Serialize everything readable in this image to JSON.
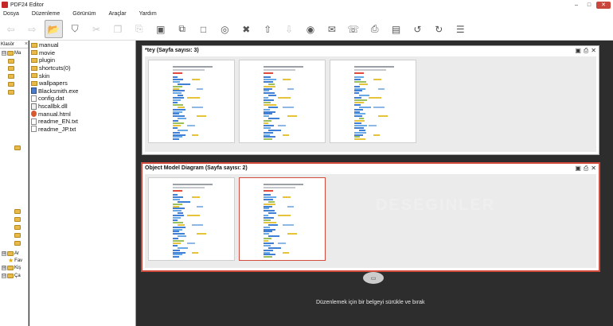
{
  "app": {
    "title": "PDF24 Editor"
  },
  "window_buttons": {
    "minimize": "–",
    "maximize": "□",
    "close": "✕"
  },
  "menu": [
    "Dosya",
    "Düzenleme",
    "Görünüm",
    "Araçlar",
    "Yardım"
  ],
  "toolbar": [
    {
      "name": "back-arrow",
      "icon": "arrow-left-icon",
      "glyph": "⇦",
      "state": "disabled"
    },
    {
      "name": "forward-arrow",
      "icon": "arrow-right-icon",
      "glyph": "⇨",
      "state": "disabled"
    },
    {
      "name": "open-folder",
      "icon": "folder-open-icon",
      "glyph": "📂",
      "state": "active"
    },
    {
      "name": "save-pdf",
      "icon": "shield-save-icon",
      "glyph": "⛉",
      "state": "normal"
    },
    {
      "name": "cut",
      "icon": "scissors-icon",
      "glyph": "✂",
      "state": "disabled"
    },
    {
      "name": "copy",
      "icon": "copy-icon",
      "glyph": "❐",
      "state": "disabled"
    },
    {
      "name": "paste",
      "icon": "paste-icon",
      "glyph": "⎘",
      "state": "disabled"
    },
    {
      "name": "save",
      "icon": "disk-icon",
      "glyph": "▣",
      "state": "normal"
    },
    {
      "name": "save-as",
      "icon": "save-as-icon",
      "glyph": "⧉",
      "state": "normal"
    },
    {
      "name": "new-page",
      "icon": "blank-page-icon",
      "glyph": "□",
      "state": "normal"
    },
    {
      "name": "merge",
      "icon": "merge-rings-icon",
      "glyph": "◎",
      "state": "normal"
    },
    {
      "name": "delete",
      "icon": "delete-x-icon",
      "glyph": "✖",
      "state": "normal"
    },
    {
      "name": "upload",
      "icon": "up-arrow-icon",
      "glyph": "⇧",
      "state": "normal"
    },
    {
      "name": "download",
      "icon": "down-arrow-icon",
      "glyph": "⇩",
      "state": "disabled"
    },
    {
      "name": "preview",
      "icon": "eye-icon",
      "glyph": "◉",
      "state": "normal"
    },
    {
      "name": "email",
      "icon": "envelope-icon",
      "glyph": "✉",
      "state": "normal"
    },
    {
      "name": "fax",
      "icon": "fax-icon",
      "glyph": "☏",
      "state": "normal"
    },
    {
      "name": "print",
      "icon": "printer-icon",
      "glyph": "⎙",
      "state": "normal"
    },
    {
      "name": "compress",
      "icon": "compress-icon",
      "glyph": "▤",
      "state": "normal"
    },
    {
      "name": "rotate-left",
      "icon": "rotate-left-icon",
      "glyph": "↺",
      "state": "normal"
    },
    {
      "name": "rotate-right",
      "icon": "rotate-right-icon",
      "glyph": "↻",
      "state": "normal"
    },
    {
      "name": "menu",
      "icon": "list-menu-icon",
      "glyph": "☰",
      "state": "normal"
    }
  ],
  "tree": {
    "header": "Klasör",
    "close": "×",
    "items": [
      {
        "label": "Ma",
        "exp": "⊟"
      },
      {
        "label": "Ar",
        "exp": "⊞"
      },
      {
        "label": "Fav",
        "exp": ""
      },
      {
        "label": "Kiş",
        "exp": "⊞"
      },
      {
        "label": "Ça",
        "exp": "⊟"
      }
    ]
  },
  "files": [
    {
      "name": "manual",
      "type": "folder"
    },
    {
      "name": "movie",
      "type": "folder"
    },
    {
      "name": "plugin",
      "type": "folder"
    },
    {
      "name": "shortcuts(0)",
      "type": "folder"
    },
    {
      "name": "skin",
      "type": "folder"
    },
    {
      "name": "wallpapers",
      "type": "folder"
    },
    {
      "name": "Blacksmith.exe",
      "type": "exe"
    },
    {
      "name": "config.dat",
      "type": "doc"
    },
    {
      "name": "hscallbk.dll",
      "type": "dll"
    },
    {
      "name": "manual.html",
      "type": "html"
    },
    {
      "name": "readme_EN.txt",
      "type": "doc"
    },
    {
      "name": "readme_JP.txt",
      "type": "doc"
    }
  ],
  "documents": [
    {
      "title": "*tey (Sayfa sayısı: 3)",
      "pages": 3,
      "selected_pages": []
    },
    {
      "title": "Object Model Diagram (Sayfa sayısı: 2)",
      "pages": 2,
      "selected_pages": [
        1
      ]
    }
  ],
  "panel_icons": {
    "save": "▣",
    "print": "⎙",
    "close": "✕"
  },
  "drop_hint": "Düzenlemek için bir belgeyi sürükle ve bırak",
  "drop_icon": "▭",
  "watermark": "DESEGINLER",
  "colors": {
    "selection": "#d24b3c",
    "workspace": "#2d2d2d"
  }
}
